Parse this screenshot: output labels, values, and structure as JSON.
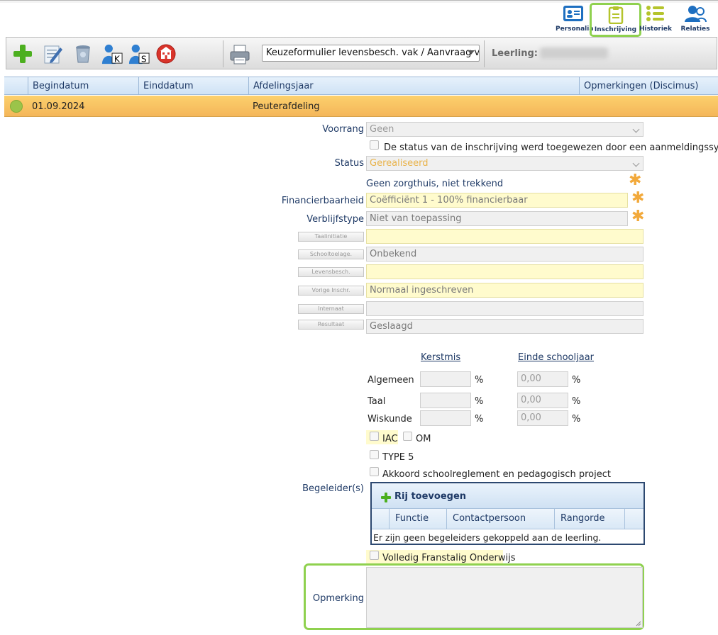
{
  "nav": {
    "items": [
      {
        "label": "Personalia",
        "icon": "id-card-icon"
      },
      {
        "label": "Inschrijving",
        "icon": "clipboard-icon"
      },
      {
        "label": "Historiek",
        "icon": "list-icon"
      },
      {
        "label": "Relaties",
        "icon": "users-icon"
      }
    ],
    "active": "Inschrijving"
  },
  "toolbar": {
    "icons": [
      "add-icon",
      "edit-icon",
      "delete-icon",
      "student-k-icon",
      "student-s-icon",
      "school-icon",
      "print-icon"
    ],
    "document_select": "Keuzeformulier levensbesch. vak / Aanvraag vrijstelling",
    "leerling_label": "Leerling:"
  },
  "grid": {
    "columns": [
      "Begindatum",
      "Einddatum",
      "Afdelingsjaar",
      "Opmerkingen (Discimus)"
    ],
    "rows": [
      {
        "begindatum": "01.09.2024",
        "einddatum": "",
        "afdelingsjaar": "Peuterafdeling",
        "opmerkingen": ""
      }
    ]
  },
  "form": {
    "voorrang": {
      "label": "Voorrang",
      "value": "Geen"
    },
    "aanmelding_checkbox": "De status van de inschrijving werd toegewezen door een aanmeldingssysteem",
    "status": {
      "label": "Status",
      "value": "Gerealiseerd"
    },
    "zorgthuis": "Geen zorgthuis, niet trekkend",
    "financierbaarheid": {
      "label": "Financierbaarheid",
      "value": "Coëfficiënt 1 - 100% financierbaar"
    },
    "verblijfstype": {
      "label": "Verblijfstype",
      "value": "Niet van toepassing"
    },
    "taalinitiatie": {
      "label": "Taalinitiatie",
      "value": ""
    },
    "schooltoelage": {
      "label": "Schooltoelage.",
      "value": "Onbekend"
    },
    "levensbesch": {
      "label": "Levensbesch.",
      "value": ""
    },
    "vorige_inschr": {
      "label": "Vorige Inschr.",
      "value": "Normaal ingeschreven"
    },
    "internaat": {
      "label": "Internaat",
      "value": ""
    },
    "resultaat": {
      "label": "Resultaat",
      "value": "Geslaagd"
    }
  },
  "scores": {
    "col_kerstmis": "Kerstmis",
    "col_einde": "Einde schooljaar",
    "pct": "%",
    "rows": [
      {
        "label": "Algemeen",
        "kerstmis": "",
        "einde": "0,00"
      },
      {
        "label": "Taal",
        "kerstmis": "",
        "einde": "0,00"
      },
      {
        "label": "Wiskunde",
        "kerstmis": "",
        "einde": "0,00"
      }
    ]
  },
  "checks": {
    "iac": "IAC",
    "om": "OM",
    "type5": "TYPE 5",
    "akkoord": "Akkoord schoolreglement en pedagogisch project",
    "frans": "Volledig Franstalig Onderwijs"
  },
  "begeleiders": {
    "label": "Begeleider(s)",
    "add_button": "Rij toevoegen",
    "columns": [
      "Functie",
      "Contactpersoon",
      "Rangorde"
    ],
    "empty": "Er zijn geen begeleiders gekoppeld aan de leerling."
  },
  "opmerking": {
    "label": "Opmerking",
    "value": ""
  },
  "colors": {
    "accent_green": "#8fd14f",
    "selected_row": "#f4b65a",
    "header_blue": "#cfe2f5",
    "text_blue": "#1f3a66"
  }
}
